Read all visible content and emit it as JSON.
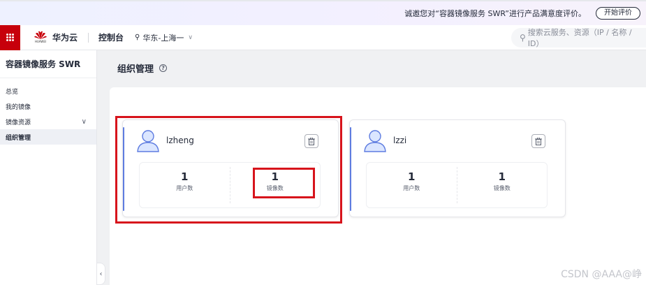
{
  "notice": {
    "text": "诚邀您对“容器镜像服务 SWR”进行产品满意度评价。",
    "button": "开始评价"
  },
  "header": {
    "brand_name": "华为云",
    "brand_sub": "HUAWEI",
    "console": "控制台",
    "region": "华东-上海一",
    "search_placeholder": "搜索云服务、资源（IP / 名称 / ID）"
  },
  "sidebar": {
    "title": "容器镜像服务 SWR",
    "items": [
      {
        "label": "总览"
      },
      {
        "label": "我的镜像"
      },
      {
        "label": "镜像资源"
      },
      {
        "label": "组织管理"
      }
    ]
  },
  "page": {
    "title": "组织管理",
    "help_icon": "?"
  },
  "orgs": [
    {
      "name": "lzheng",
      "users_value": "1",
      "users_label": "用户数",
      "images_value": "1",
      "images_label": "镜像数"
    },
    {
      "name": "lzzi",
      "users_value": "1",
      "users_label": "用户数",
      "images_value": "1",
      "images_label": "镜像数"
    }
  ],
  "watermark": "CSDN @AAA@峥",
  "colors": {
    "brand_red": "#c7000b",
    "accent_blue": "#5e7ce0",
    "highlight_red": "#d7141c"
  }
}
